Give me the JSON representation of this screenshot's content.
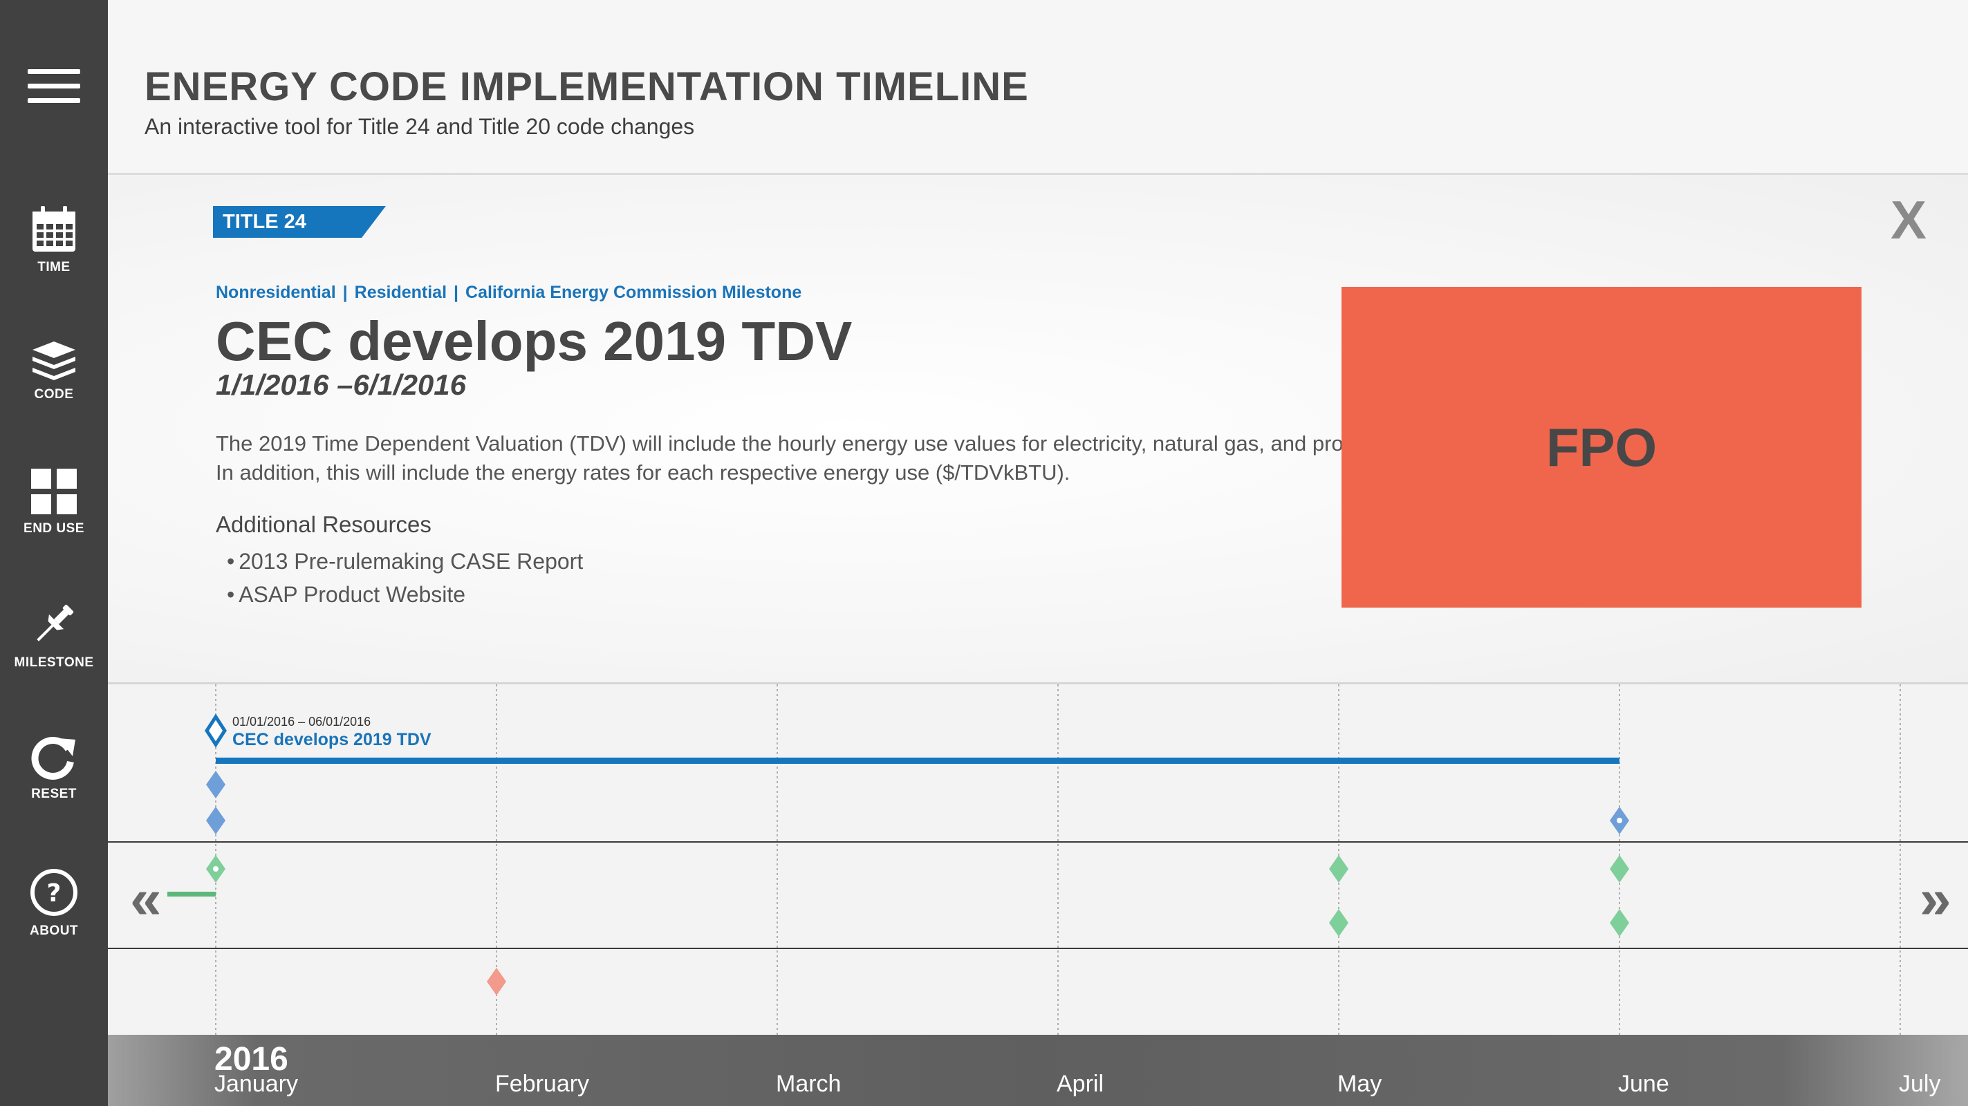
{
  "sidebar": {
    "menu_icon": "hamburger-icon",
    "items": [
      {
        "label": "TIME",
        "icon": "calendar-icon"
      },
      {
        "label": "CODE",
        "icon": "layers-icon"
      },
      {
        "label": "END USE",
        "icon": "grid-icon"
      },
      {
        "label": "MILESTONE",
        "icon": "pushpin-icon"
      },
      {
        "label": "RESET",
        "icon": "refresh-icon"
      },
      {
        "label": "ABOUT",
        "icon": "help-icon"
      }
    ]
  },
  "header": {
    "title": "ENERGY CODE IMPLEMENTATION TIMELINE",
    "subtitle": "An interactive tool for Title 24 and Title 20 code changes"
  },
  "detail": {
    "tag": "TITLE 24",
    "close_label": "X",
    "categories": [
      "Nonresidential",
      "Residential",
      "California Energy Commission Milestone"
    ],
    "category_separator": "|",
    "title": "CEC develops 2019 TDV",
    "dates": "1/1/2016 –6/1/2016",
    "description": "The 2019 Time Dependent Valuation (TDV) will include the hourly energy use values for electricity, natural gas, and propane. In addition, this will include the energy rates for each respective energy use ($/TDVkBTU).",
    "resources_heading": "Additional Resources",
    "resource_bullet": "•",
    "resources": [
      "2013 Pre-rulemaking CASE Report",
      "ASAP Product Website"
    ],
    "image_label": "FPO",
    "image_color": "#f0664c"
  },
  "timeline": {
    "prev_label": "«",
    "next_label": "»",
    "year": "2016",
    "months": [
      "January",
      "February",
      "March",
      "April",
      "May",
      "June",
      "July"
    ],
    "selected_event": {
      "date_range": "01/01/2016 – 06/01/2016",
      "title": "CEC develops 2019 TDV",
      "start_month_index": 0,
      "end_month_index": 5,
      "color": "#1576be"
    },
    "colors": {
      "blue": "#6f9fd8",
      "green": "#7fcf9a",
      "red": "#f29a8c",
      "accent": "#1576be"
    },
    "markers": [
      {
        "month_index": 0,
        "row": 1,
        "color": "blue",
        "style": "solid"
      },
      {
        "month_index": 0,
        "row": 2,
        "color": "blue",
        "style": "solid"
      },
      {
        "month_index": 5,
        "row": 2,
        "color": "blue",
        "style": "hollow"
      },
      {
        "month_index": 0,
        "row": 3,
        "color": "green",
        "style": "hollow"
      },
      {
        "month_index": 4,
        "row": 3,
        "color": "green",
        "style": "solid"
      },
      {
        "month_index": 5,
        "row": 3,
        "color": "green",
        "style": "solid"
      },
      {
        "month_index": 4,
        "row": 4,
        "color": "green",
        "style": "solid"
      },
      {
        "month_index": 5,
        "row": 4,
        "color": "green",
        "style": "solid"
      },
      {
        "month_index": 1,
        "row": 5,
        "color": "red",
        "style": "solid"
      }
    ]
  }
}
